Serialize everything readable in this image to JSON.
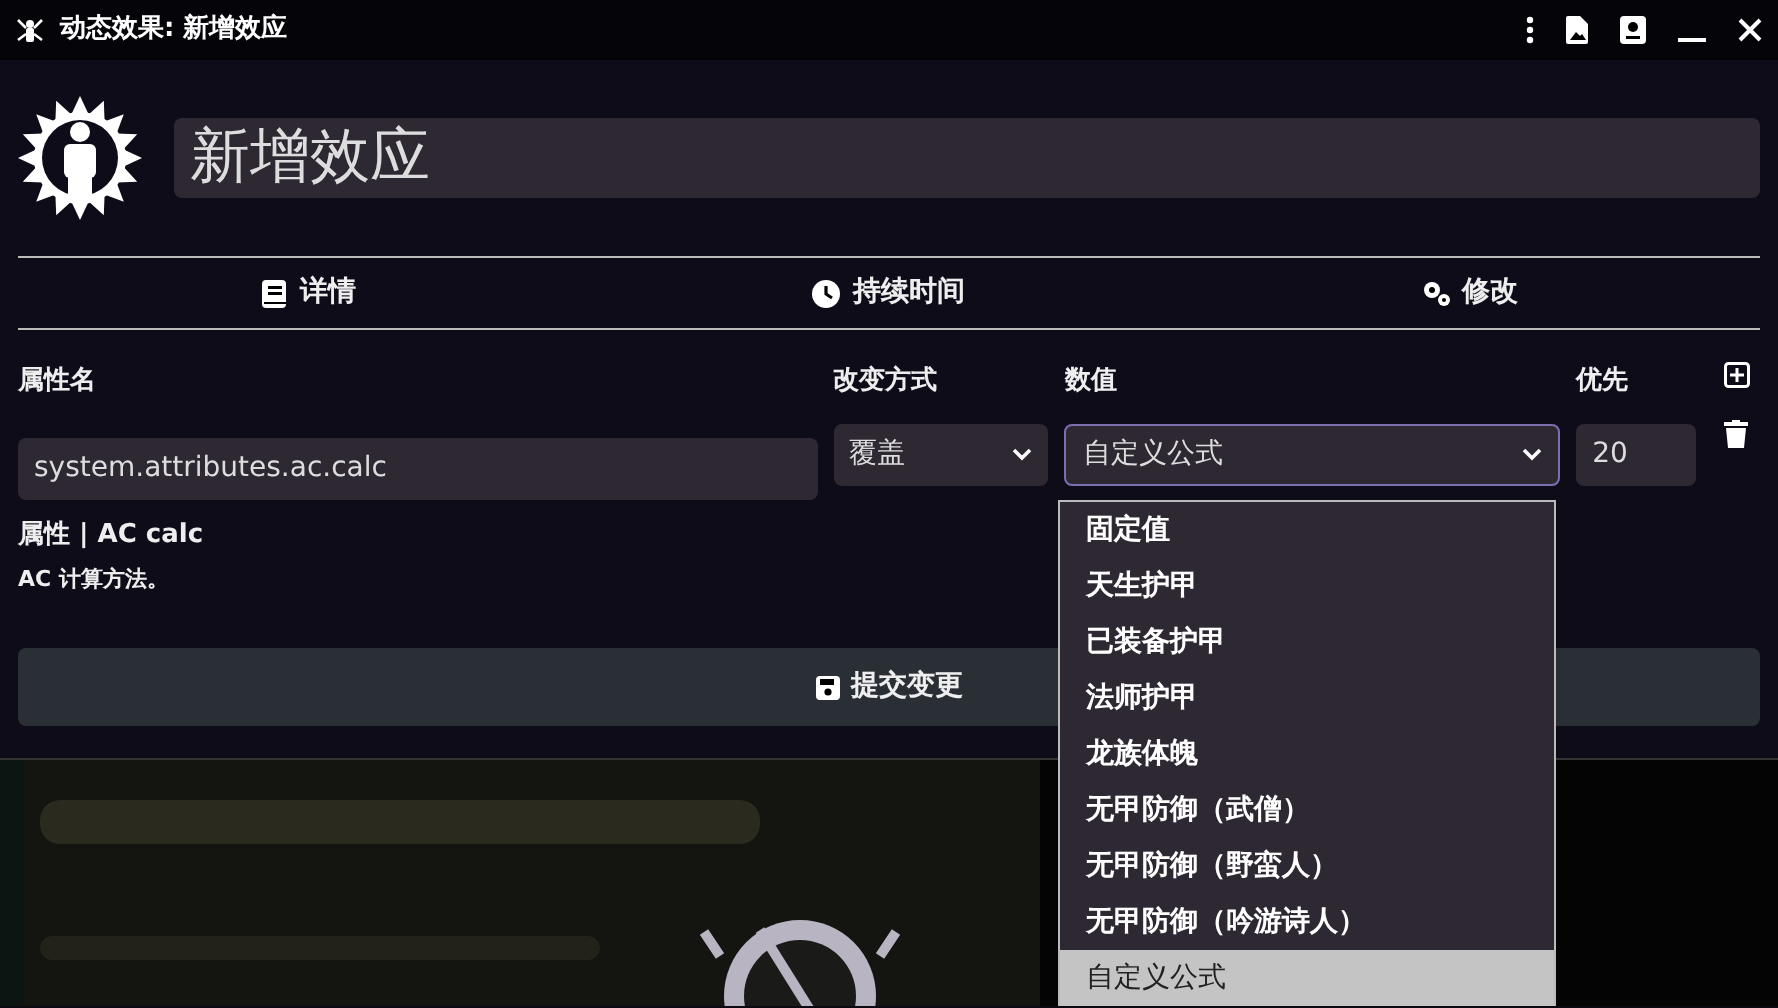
{
  "window": {
    "title": "动态效果: 新增效应"
  },
  "effect_name": {
    "value": "新增效应"
  },
  "tabs": [
    {
      "label": "详情"
    },
    {
      "label": "持续时间"
    },
    {
      "label": "修改"
    }
  ],
  "changes": {
    "columns": [
      "属性名",
      "改变方式",
      "数值",
      "优先"
    ],
    "row": {
      "key": "system.attributes.ac.calc",
      "mode": "覆盖",
      "value": "自定义公式",
      "priority": "20",
      "hint_title": "属性 | AC calc",
      "hint_text": "AC 计算方法。"
    }
  },
  "dropdown": [
    {
      "label": "固定值",
      "selected": false
    },
    {
      "label": "天生护甲",
      "selected": false
    },
    {
      "label": "已装备护甲",
      "selected": false
    },
    {
      "label": "法师护甲",
      "selected": false
    },
    {
      "label": "龙族体魄",
      "selected": false
    },
    {
      "label": "无甲防御（武僧）",
      "selected": false
    },
    {
      "label": "无甲防御（野蛮人）",
      "selected": false
    },
    {
      "label": "无甲防御（吟游诗人）",
      "selected": false
    },
    {
      "label": "自定义公式",
      "selected": true
    }
  ],
  "submit": {
    "label": "提交变更"
  }
}
